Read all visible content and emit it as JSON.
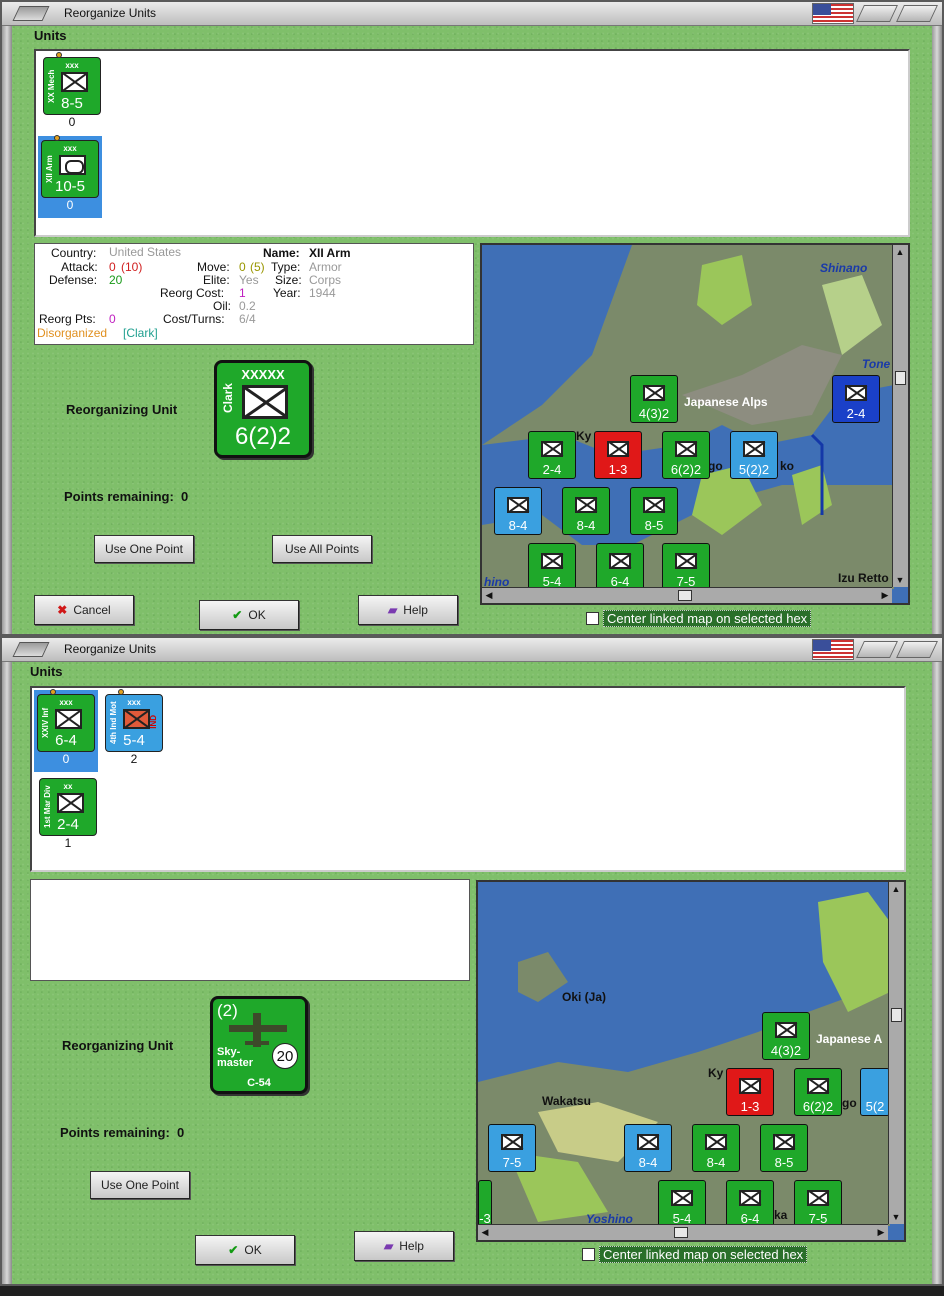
{
  "window1": {
    "title": "Reorganize Units",
    "units_label": "Units",
    "units": [
      {
        "side_name": "XX Mech",
        "size": "xxx",
        "value": "8-5",
        "count": "0",
        "color": "#1fa82a",
        "symbol": "inf"
      },
      {
        "side_name": "XII Arm",
        "size": "xxx",
        "value": "10-5",
        "count": "0",
        "color": "#1fa82a",
        "symbol": "arm"
      }
    ],
    "info": {
      "country_label": "Country:",
      "country_value": "United States",
      "attack_label": "Attack:",
      "attack_value": "0",
      "attack_extra": "(10)",
      "defense_label": "Defense:",
      "defense_value": "20",
      "reorg_pts_label": "Reorg Pts:",
      "reorg_pts_value": "0",
      "disorganized": "Disorganized",
      "disorganized_hq": "[Clark]",
      "move_label": "Move:",
      "move_value": "0",
      "move_extra": "(5)",
      "elite_label": "Elite:",
      "elite_value": "Yes",
      "reorg_cost_label": "Reorg Cost:",
      "reorg_cost_value": "1",
      "oil_label": "Oil:",
      "oil_value": "0.2",
      "cost_turns_label": "Cost/Turns:",
      "cost_turns_value": "6/4",
      "name_label": "Name:",
      "name_value": "XII Arm",
      "type_label": "Type:",
      "type_value": "Armor",
      "size_label": "Size:",
      "size_value": "Corps",
      "year_label": "Year:",
      "year_value": "1944"
    },
    "reorganizing_label": "Reorganizing Unit",
    "reorg_unit": {
      "size": "XXXXX",
      "side_name": "Clark",
      "value": "6(2)2"
    },
    "points_label": "Points remaining:",
    "points_value": "0",
    "use_one_label": "Use One Point",
    "use_all_label": "Use All Points",
    "cancel_label": "Cancel",
    "ok_label": "OK",
    "help_label": "Help",
    "center_checkbox_label": "Center linked map on selected hex",
    "map_labels": {
      "shinano": "Shinano",
      "japanese_alps": "Japanese Alps",
      "tone": "Tone",
      "izu": "Izu Retto",
      "kyo": "Ky",
      "ko": "ko",
      "go": "go",
      "hino": "hino"
    },
    "map_counters": [
      "4(3)2",
      "2-4",
      "1-3",
      "6(2)2",
      "5(2)2",
      "2-4",
      "8-4",
      "8-4",
      "8-5",
      "5-4",
      "6-4",
      "7-5"
    ]
  },
  "window2": {
    "title": "Reorganize Units",
    "units_label": "Units",
    "units": [
      {
        "side_name": "XXIV Inf",
        "size": "xxx",
        "value": "6-4",
        "count": "0",
        "color": "#1fa82a",
        "symbol": "inf",
        "selected": true
      },
      {
        "side_name": "4th Ind Mot",
        "size": "xxx",
        "value": "5-4",
        "count": "2",
        "color": "#3aa0e0",
        "symbol": "inf",
        "badge": "IND"
      },
      {
        "side_name": "1st Mar Div",
        "size": "xx",
        "value": "2-4",
        "count": "1",
        "color": "#1fa82a",
        "symbol": "inf"
      }
    ],
    "reorganizing_label": "Reorganizing Unit",
    "reorg_unit": {
      "prefix": "(2)",
      "name": "Sky-\nmaster",
      "range": "20",
      "type": "C-54",
      "size": "xxx"
    },
    "points_label": "Points remaining:",
    "points_value": "0",
    "use_one_label": "Use One Point",
    "ok_label": "OK",
    "help_label": "Help",
    "center_checkbox_label": "Center linked map on selected hex",
    "map_labels": {
      "oki": "Oki (Ja)",
      "japanese_a": "Japanese A",
      "wakatsu": "Wakatsu",
      "yoshino": "Yoshino",
      "ky": "Ky",
      "go": "go",
      "ka": "ka"
    },
    "map_counters": [
      "4(3)2",
      "1-3",
      "6(2)2",
      "5(2",
      "7-5",
      "8-4",
      "8-4",
      "8-5",
      "5-4",
      "6-4",
      "7-5",
      "-3"
    ]
  }
}
